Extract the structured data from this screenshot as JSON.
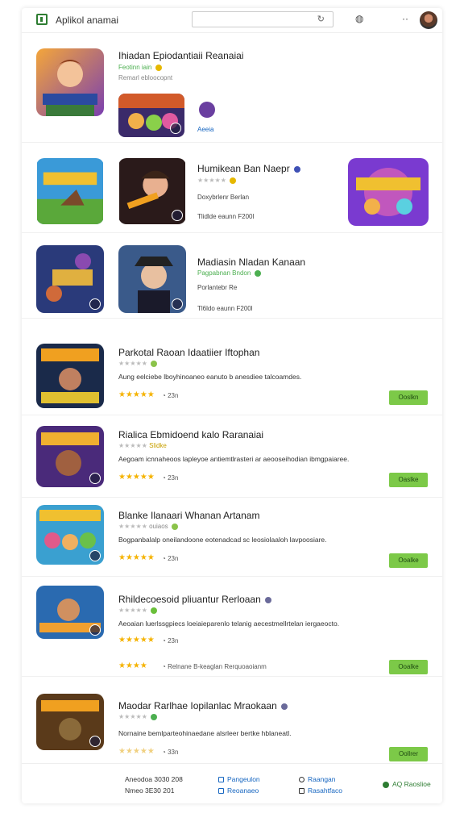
{
  "header": {
    "title": "Aplikol anamai",
    "search_placeholder": "",
    "refresh_icon": "refresh-icon",
    "bell_icon": "bell-icon",
    "more_label": "··"
  },
  "featured": [
    {
      "title": "Ihiadan Epiodantiaii Reanaiai",
      "sub": "Feotinn iain",
      "meta": "Remarl ebloocopnt",
      "extra_label": "Aeeia"
    },
    {
      "title": "Humikean Ban Naepr",
      "sub": "",
      "meta": "Doxybrlenr Berlan",
      "meta2": "Tlidlde eaunn F200l"
    },
    {
      "title": "Madiasin Nladan Kanaan",
      "sub": "Pagpabnan Bndon",
      "meta": "Porlantebr Re",
      "meta2": "Tl6ldo eaunn F200l"
    }
  ],
  "apps": [
    {
      "title": "Parkotal Raoan Idaatiier Iftophan",
      "sub": "",
      "desc": "Aung eelciebe lboyhinoaneo eanuto b anesdiee talcoamdes.",
      "rating_count": "23n",
      "button": "Ooslkn"
    },
    {
      "title": "Rialica Ebmidoend kalo Raranaiai",
      "sub": "Slidke",
      "desc": "Aegoam icnnaheoos lapleyoe antiemtlrasteri ar aeooseihodian ibmgpaiaree.",
      "rating_count": "23n",
      "button": "Oaslke"
    },
    {
      "title": "Blanke Ilanaari Whanan Artanam",
      "sub": "ouiaos",
      "desc": "Bogpanbalalp oneilandoone eotenadcad sc leosiolaaloh lavpoosiare.",
      "rating_count": "23n",
      "button": "Ooalke"
    },
    {
      "title": "Rhildecoesoid pliuantur Rerloaan",
      "sub": "",
      "desc": "Aeoaian luerlssgpiecs loeiaieparenlo telanig aecestmellrtelan iergaeocto.",
      "rating_count": "23n",
      "extra": "Relnane B-keaglan Rerquoaoianm",
      "button": "Ooalke"
    },
    {
      "title": "Maodar Rarlhae Iopilanlac Mraokaan",
      "sub": "",
      "desc": "Nornaine bemlparteohinaedane alsrleer bertke hblaneatl.",
      "rating_count": "33n",
      "button": "Oollrer"
    }
  ],
  "footer": {
    "left1": "Aneodoa 3030 208",
    "left2": "Nmeo 3E30 201",
    "link1": "Pangeulon",
    "link2": "Reoanaeo",
    "link3": "Raangan",
    "link4": "Rasahtfaco",
    "right": "AQ Raoslioe"
  },
  "colors": {
    "accent_green": "#7cc948",
    "link_blue": "#1565c0",
    "star": "#f5b301"
  }
}
